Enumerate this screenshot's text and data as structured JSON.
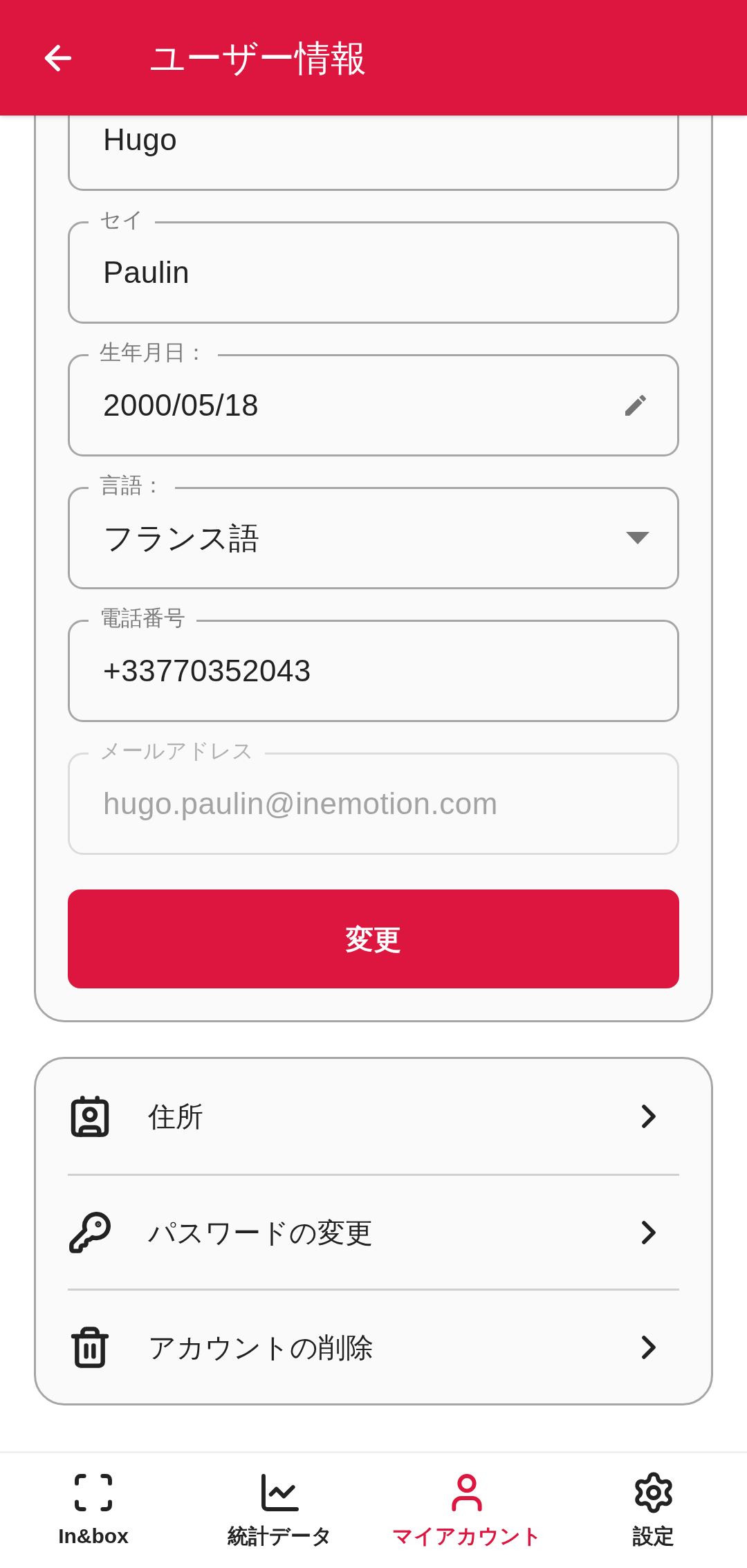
{
  "app_bar": {
    "title": "ユーザー情報"
  },
  "profile_form": {
    "fields": [
      {
        "kind": "text",
        "value": "Hugo",
        "disabled": false
      },
      {
        "kind": "text",
        "label": "セイ",
        "value": "Paulin",
        "disabled": false
      },
      {
        "kind": "date",
        "label": "生年月日：",
        "value": "2000/05/18",
        "disabled": false
      },
      {
        "kind": "select",
        "label": "言語：",
        "value": "フランス語",
        "disabled": false
      },
      {
        "kind": "text",
        "label": "電話番号",
        "value": "+33770352043",
        "disabled": false
      },
      {
        "kind": "text",
        "label": "メールアドレス",
        "value": "hugo.paulin@inemotion.com",
        "disabled": true
      }
    ],
    "submit_button": "変更"
  },
  "account_menu": [
    {
      "kind": "address",
      "label": "住所"
    },
    {
      "kind": "password",
      "label": "パスワードの変更"
    },
    {
      "kind": "delete",
      "label": "アカウントの削除"
    }
  ],
  "bottom_nav": [
    {
      "kind": "scan",
      "label": "In&box",
      "selected": false
    },
    {
      "kind": "stats",
      "label": "統計データ",
      "selected": false
    },
    {
      "kind": "account",
      "label": "マイアカウント",
      "selected": true
    },
    {
      "kind": "settings",
      "label": "設定",
      "selected": false
    }
  ]
}
